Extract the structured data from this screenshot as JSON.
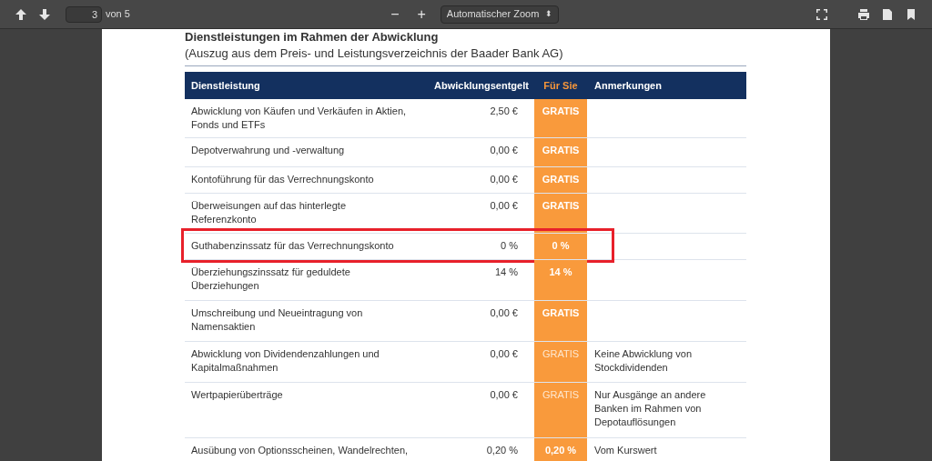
{
  "toolbar": {
    "page": "3",
    "page_total": "von 5",
    "zoom_minus": "−",
    "zoom_plus": "+",
    "zoom": "Automatischer Zoom",
    "zoom_caret": "⬍"
  },
  "document": {
    "heading": "Dienstleistungen im Rahmen der Abwicklung",
    "subheading": "(Auszug aus dem Preis- und Leistungsverzeichnis der Baader Bank AG)",
    "table": {
      "columns": [
        "Dienstleistung",
        "Abwicklungsentgelt",
        "Für Sie",
        "Anmerkungen"
      ],
      "rows": [
        {
          "service": "Abwicklung von Käufen und Verkäufen in Aktien, Fonds und ETFs",
          "fee": "2,50 €",
          "for_you": "GRATIS",
          "bold": true,
          "note": "",
          "highlighted": false
        },
        {
          "service": "Depotverwahrung und -verwaltung",
          "fee": "0,00 €",
          "for_you": "GRATIS",
          "bold": true,
          "note": "",
          "highlighted": false
        },
        {
          "service": "Kontoführung für das Verrechnungskonto",
          "fee": "0,00 €",
          "for_you": "GRATIS",
          "bold": true,
          "note": "",
          "highlighted": false
        },
        {
          "service": "Überweisungen auf das hinterlegte Referenzkonto",
          "fee": "0,00 €",
          "for_you": "GRATIS",
          "bold": true,
          "note": "",
          "highlighted": false
        },
        {
          "service": "Guthabenzinssatz für das Verrechnungskonto",
          "fee": "0 %",
          "for_you": "0 %",
          "bold": true,
          "note": "",
          "highlighted": true
        },
        {
          "service": "Überziehungszinssatz für geduldete Überziehungen",
          "fee": "14 %",
          "for_you": "14 %",
          "bold": true,
          "note": "",
          "highlighted": false
        },
        {
          "service": "Umschreibung und Neueintragung von Namensaktien",
          "fee": "0,00 €",
          "for_you": "GRATIS",
          "bold": true,
          "note": "",
          "highlighted": false
        },
        {
          "service": "Abwicklung von Dividendenzahlungen und Kapitalmaßnahmen",
          "fee": "0,00 €",
          "for_you": "GRATIS",
          "bold": false,
          "note": "Keine Abwicklung von Stockdividenden",
          "highlighted": false
        },
        {
          "service": "Wertpapierüberträge",
          "fee": "0,00 €",
          "for_you": "GRATIS",
          "bold": false,
          "note": "Nur Ausgänge an andere Banken im Rahmen von Depotauflösungen",
          "highlighted": false
        },
        {
          "service": "Ausübung von Optionsscheinen, Wandelrechten,",
          "fee": "0,20 %",
          "for_you": "0,20 %",
          "bold": true,
          "note": "Vom Kurswert",
          "highlighted": false
        }
      ]
    }
  }
}
